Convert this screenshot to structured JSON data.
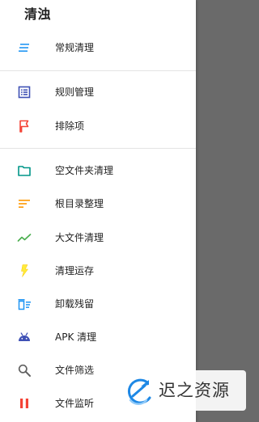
{
  "drawer": {
    "title": "清浊",
    "items": [
      {
        "label": "常规清理",
        "icon": "clean-lines-icon",
        "color": "#2196F3"
      },
      {
        "label": "规则管理",
        "icon": "list-icon",
        "color": "#3F51B5"
      },
      {
        "label": "排除项",
        "icon": "flag-icon",
        "color": "#F44336"
      },
      {
        "label": "空文件夹清理",
        "icon": "folder-icon",
        "color": "#009688"
      },
      {
        "label": "根目录整理",
        "icon": "sort-lines-icon",
        "color": "#FF9800"
      },
      {
        "label": "大文件清理",
        "icon": "trend-line-icon",
        "color": "#4CAF50"
      },
      {
        "label": "清理运存",
        "icon": "flash-icon",
        "color": "#FFEB3B"
      },
      {
        "label": "卸载残留",
        "icon": "delete-sweep-icon",
        "color": "#2196F3"
      },
      {
        "label": "APK 清理",
        "icon": "android-icon",
        "color": "#3F51B5"
      },
      {
        "label": "文件筛选",
        "icon": "search-icon",
        "color": "#616161"
      },
      {
        "label": "文件监听",
        "icon": "pause-icon",
        "color": "#F44336"
      }
    ]
  },
  "watermark": {
    "text": "迟之资源",
    "color": "#1E88E5"
  }
}
